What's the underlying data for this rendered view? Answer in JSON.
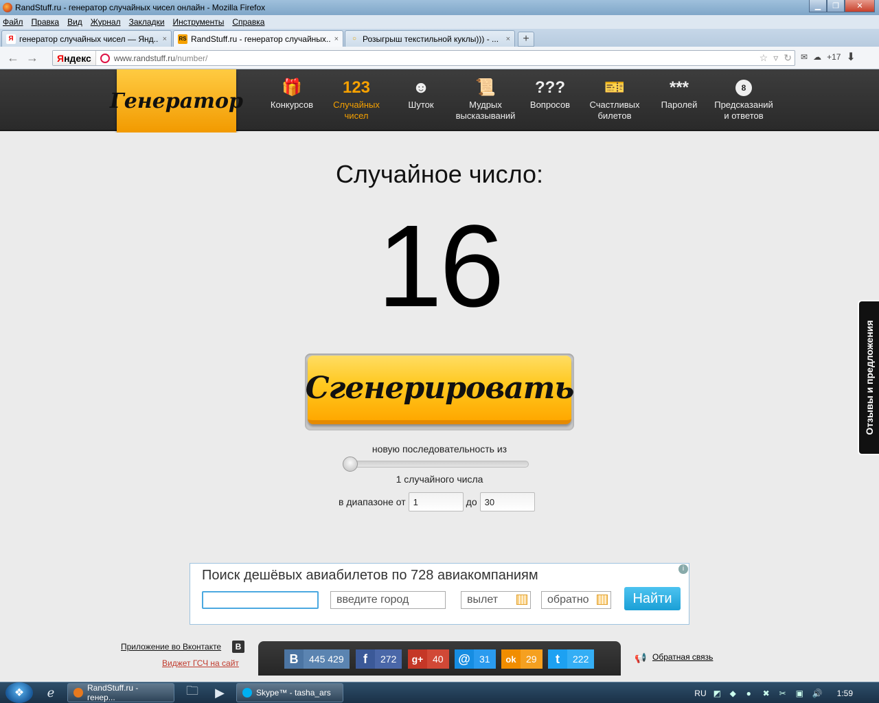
{
  "window": {
    "title": "RandStuff.ru - генератор случайных чисел онлайн - Mozilla Firefox"
  },
  "menu": [
    "Файл",
    "Правка",
    "Вид",
    "Журнал",
    "Закладки",
    "Инструменты",
    "Справка"
  ],
  "tabs": [
    {
      "label": "генератор случайных чисел — Янд...",
      "close": "×",
      "icon": "Я"
    },
    {
      "label": "RandStuff.ru - генератор случайных...",
      "close": "×",
      "icon": "RS"
    },
    {
      "label": "Розыгрыш текстильной куклы))) - ...",
      "close": "×",
      "icon": "○"
    }
  ],
  "new_tab": "+",
  "navbar": {
    "yandex_logo_y": "Я",
    "yandex_logo_rest": "ндекс",
    "url_host": "www.randstuff.ru",
    "url_path": "/number/",
    "weather": "+17"
  },
  "site": {
    "logo": "Генератор",
    "nav": [
      {
        "icon": "🎁",
        "label": "Конкурсов"
      },
      {
        "icon": "123",
        "label": "Случайных чисел"
      },
      {
        "icon": "☻",
        "label": "Шуток"
      },
      {
        "icon": "📜",
        "label": "Мудрых высказываний"
      },
      {
        "icon": "???",
        "label": "Вопросов"
      },
      {
        "icon": "🎫",
        "label": "Счастливых билетов"
      },
      {
        "icon": "***",
        "label": "Паролей"
      },
      {
        "icon": "8",
        "label": "Предсказаний и ответов"
      }
    ],
    "active_nav_index": 1
  },
  "main": {
    "heading": "Случайное число:",
    "number": "16",
    "generate_button": "Сгенерировать",
    "sequence_label": "новую последовательность из",
    "slider_value": 1,
    "count_label": "1 случайного числа",
    "range_from_label": "в диапазоне от",
    "range_from": "1",
    "range_to_label": "до",
    "range_to": "30"
  },
  "ad": {
    "title": "Поиск дешёвых авиабилетов по 728 авиакомпаниям",
    "info": "i",
    "from_value": "",
    "to_placeholder": "введите город",
    "depart_placeholder": "вылет",
    "return_placeholder": "обратно",
    "button": "Найти"
  },
  "footer": {
    "vk_app": "Приложение во Вконтакте",
    "vk_badge": "В",
    "widget": "Виджет ГСЧ на сайт",
    "feedback": "Обратная связь",
    "social": [
      {
        "icon": "В",
        "count": "445 429",
        "color": "#4c75a3",
        "count_bg": "#5b84b1"
      },
      {
        "icon": "f",
        "count": "272",
        "color": "#3b5998",
        "count_bg": "#4a67a8"
      },
      {
        "icon": "g+",
        "count": "40",
        "color": "#c53727",
        "count_bg": "#d14836"
      },
      {
        "icon": "@",
        "count": "31",
        "color": "#168de2",
        "count_bg": "#2a9bef"
      },
      {
        "icon": "ok",
        "count": "29",
        "color": "#f18d00",
        "count_bg": "#f5a020"
      },
      {
        "icon": "t",
        "count": "222",
        "color": "#1da1f2",
        "count_bg": "#34aef5"
      }
    ]
  },
  "side_tab": "Отзывы и предложения",
  "taskbar": {
    "tasks": [
      {
        "label": "RandStuff.ru - генер...",
        "color": "#e8791e"
      },
      {
        "label": "Skype™ - tasha_ars",
        "color": "#00aff0"
      }
    ],
    "lang": "RU",
    "clock": "1:59"
  }
}
